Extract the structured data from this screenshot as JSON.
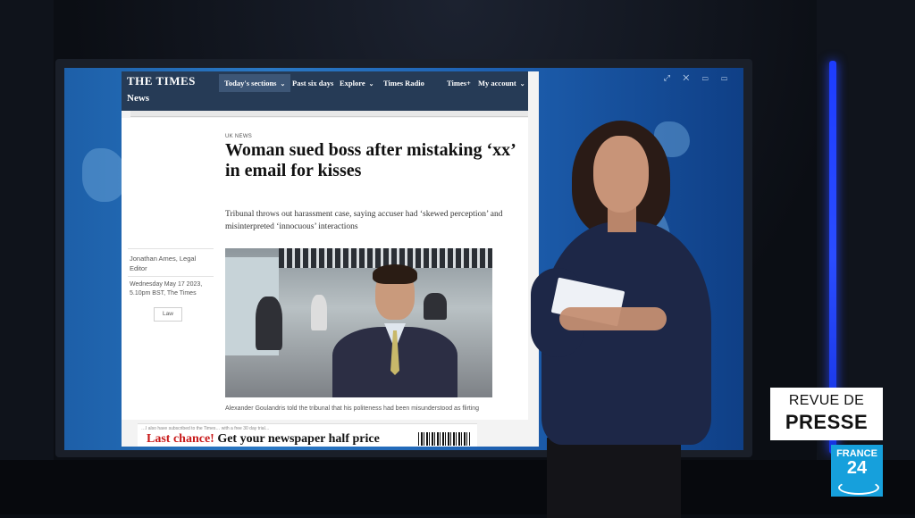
{
  "site": {
    "logo": "THE TIMES",
    "nav": [
      {
        "label": "Today's sections",
        "chevron": true
      },
      {
        "label": "Past six days",
        "chevron": false
      },
      {
        "label": "Explore",
        "chevron": true
      },
      {
        "label": "Times Radio",
        "chevron": false
      },
      {
        "label": "Times+",
        "chevron": false
      },
      {
        "label": "My account",
        "chevron": true
      }
    ],
    "section_title": "News"
  },
  "article": {
    "section_label": "UK NEWS",
    "headline": "Woman sued boss after mistaking ‘xx’ in email for kisses",
    "standfirst": "Tribunal throws out harassment case, saying accuser had ‘skewed perception’ and misinterpreted ‘innocuous’ interactions",
    "byline": "Jonathan Ames, Legal Editor",
    "dateline": "Wednesday May 17 2023, 5.10pm BST, The Times",
    "tag": "Law",
    "photo_caption": "Alexander Goulandris told the tribunal that his politeness had been misunderstood as flirting"
  },
  "promo": {
    "small_text": "…I also have subscribed to the Times… with a free 30 day trial…",
    "highlight": "Last chance!",
    "text": "Get your newspaper half price"
  },
  "branding": {
    "revue_line1": "REVUE DE",
    "revue_line2": "PRESSE",
    "channel_name": "FRANCE",
    "channel_number": "24"
  },
  "colors": {
    "times_header": "#263b56",
    "screen_blue": "#2a78c4",
    "neon_blue": "#2a4cff",
    "france24": "#16a0dc",
    "promo_red": "#c81a1a"
  }
}
